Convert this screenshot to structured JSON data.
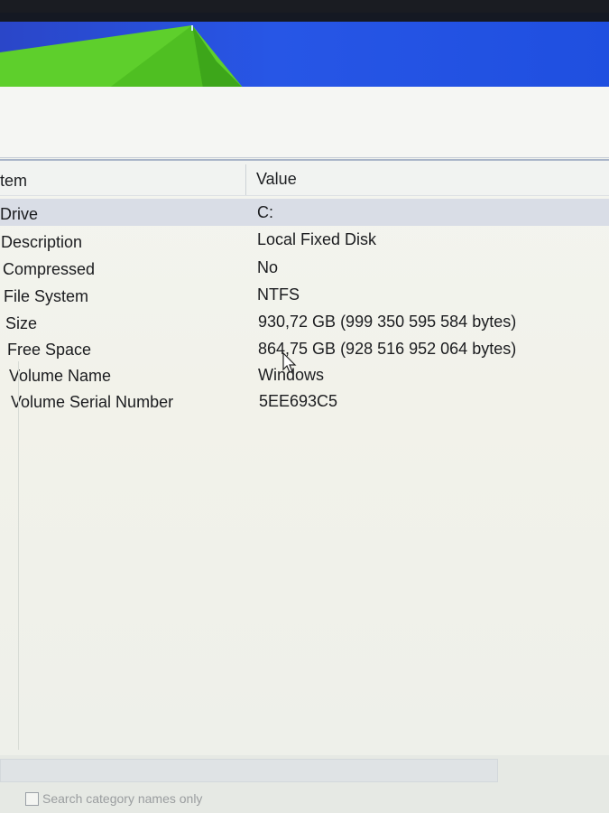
{
  "table": {
    "headers": {
      "item": "tem",
      "value": "Value"
    },
    "rows": [
      {
        "item": "Drive",
        "value": "C:"
      },
      {
        "item": "Description",
        "value": "Local Fixed Disk"
      },
      {
        "item": "Compressed",
        "value": "No"
      },
      {
        "item": "File System",
        "value": "NTFS"
      },
      {
        "item": "Size",
        "value": "930,72 GB (999 350 595 584 bytes)"
      },
      {
        "item": "Free Space",
        "value": "864,75 GB (928 516 952 064 bytes)"
      },
      {
        "item": "Volume Name",
        "value": "Windows"
      },
      {
        "item": "Volume Serial Number",
        "value": "5EE693C5"
      }
    ]
  },
  "footer": {
    "search_category_names_only": "Search category names only"
  },
  "colors": {
    "selection": "#d9dde6",
    "wallpaper_blue": "#2756e6",
    "tent_green": "#5ed12a"
  }
}
